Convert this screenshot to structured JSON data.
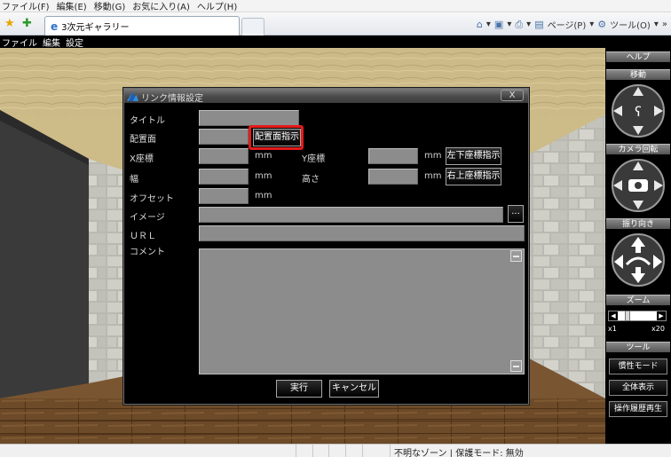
{
  "ie": {
    "menu": [
      "ファイル(F)",
      "編集(E)",
      "移動(G)",
      "お気に入り(A)",
      "ヘルプ(H)"
    ],
    "tab_title": "3次元ギャラリー",
    "cmd_page": "ページ(P)",
    "cmd_tools": "ツール(O)",
    "chevron": "»",
    "icons": [
      "favorites-star-icon",
      "add-favorite-icon",
      "ie-page-icon",
      "home-icon",
      "feeds-icon",
      "print-icon",
      "page-icon",
      "tools-gear-icon"
    ]
  },
  "app_menu": [
    "ファイル",
    "編集",
    "設定"
  ],
  "dialog": {
    "title": "リンク情報設定",
    "close": "X",
    "labels": {
      "title": "タイトル",
      "placement": "配置面",
      "x": "X座標",
      "y": "Y座標",
      "width": "幅",
      "height": "高さ",
      "offset": "オフセット",
      "image": "イメージ",
      "url": "ＵＲＬ",
      "comment": "コメント"
    },
    "unit": "mm",
    "buttons": {
      "placement_select": "配置面指示",
      "top_left": "左下座標指示",
      "top_right": "右上座標指示",
      "browse": "...",
      "execute": "実行",
      "cancel": "キャンセル"
    },
    "values": {
      "title": "",
      "placement": "",
      "x": "",
      "y": "",
      "width": "",
      "height": "",
      "offset": "",
      "image": "",
      "url": "",
      "comment": ""
    },
    "highlight_color": "#e31b1b"
  },
  "panel": {
    "help": "ヘルプ",
    "move": "移動",
    "camera": "カメラ回転",
    "direction": "振り向き",
    "zoom": "ズーム",
    "zoom_min": "x1",
    "zoom_max": "x20",
    "zoom_level": 0.2,
    "tools": "ツール",
    "inertia_mode": "慣性モード",
    "show_all": "全体表示",
    "replay_history": "操作履歴再生"
  },
  "status": {
    "zone": "不明なゾーン | 保護モード: 無効"
  }
}
